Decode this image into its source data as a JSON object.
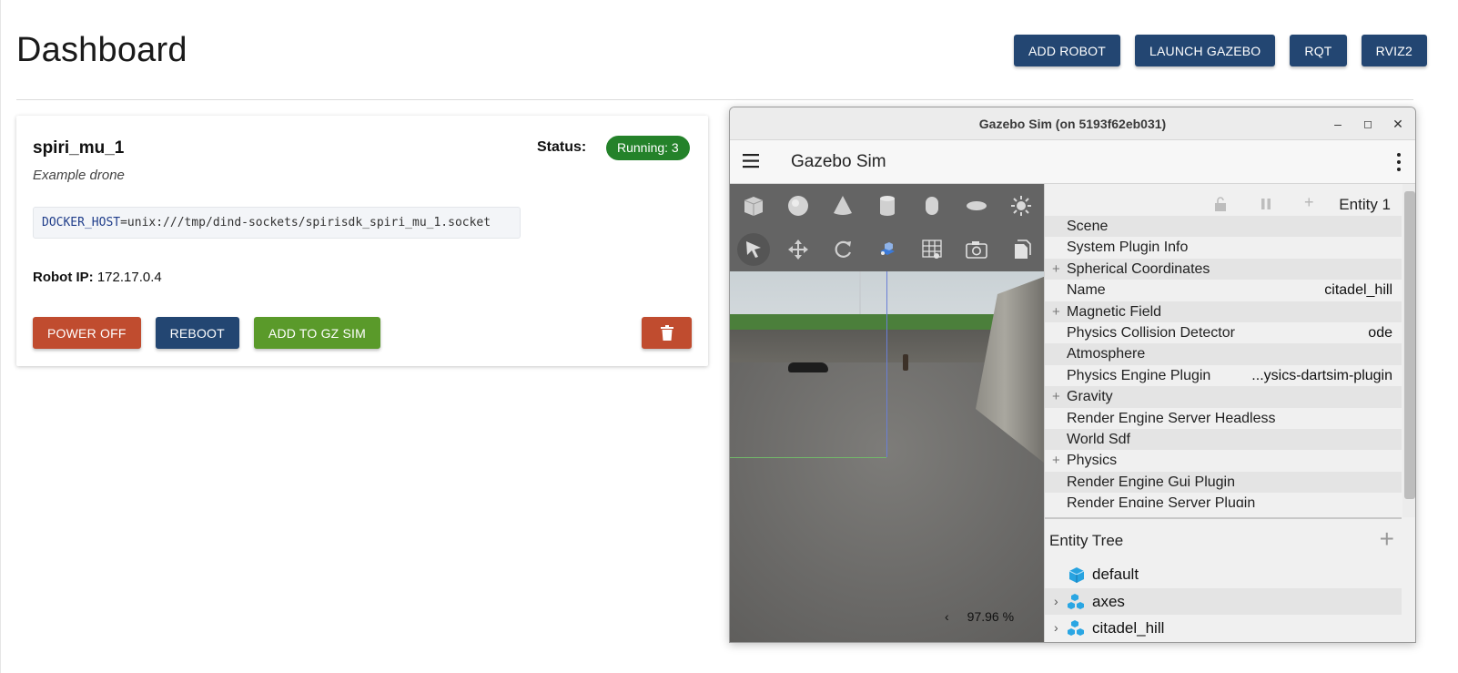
{
  "header": {
    "title": "Dashboard",
    "buttons": [
      "ADD ROBOT",
      "LAUNCH GAZEBO",
      "RQT",
      "RVIZ2"
    ]
  },
  "robot": {
    "name": "spiri_mu_1",
    "description": "Example drone",
    "status_label": "Status:",
    "status": "Running: 3",
    "env_key": "DOCKER_HOST",
    "env_value": "=unix:///tmp/dind-sockets/spirisdk_spiri_mu_1.socket",
    "ip_label": "Robot IP:",
    "ip": "172.17.0.4",
    "actions": {
      "power_off": "POWER OFF",
      "reboot": "REBOOT",
      "add_to_gz": "ADD TO GZ SIM"
    }
  },
  "gazebo": {
    "window_title": "Gazebo Sim (on 5193f62eb031)",
    "app_title": "Gazebo Sim",
    "window_controls": {
      "minimize": "–",
      "maximize": "◻",
      "close": "✕"
    },
    "toolbar_row1": [
      "box-icon",
      "sphere-icon",
      "cone-icon",
      "cylinder-icon",
      "capsule-icon",
      "ellipsoid-icon",
      "light-icon",
      "lines-icon",
      "grid-points-icon"
    ],
    "toolbar_row2": [
      "select-icon",
      "translate-icon",
      "rotate-icon",
      "view-angle-icon",
      "grid-config-icon",
      "screenshot-icon",
      "copy-icon",
      "paste-icon"
    ],
    "entity_label": "Entity 1",
    "components": [
      {
        "label": "Scene",
        "expand": false,
        "value": ""
      },
      {
        "label": "System Plugin Info",
        "expand": false,
        "value": ""
      },
      {
        "label": "Spherical Coordinates",
        "expand": true,
        "value": ""
      },
      {
        "label": "Name",
        "expand": false,
        "value": "citadel_hill"
      },
      {
        "label": "Magnetic Field",
        "expand": true,
        "value": ""
      },
      {
        "label": "Physics Collision Detector",
        "expand": false,
        "value": "ode"
      },
      {
        "label": "Atmosphere",
        "expand": false,
        "value": ""
      },
      {
        "label": "Physics Engine Plugin",
        "expand": false,
        "value": "...ysics-dartsim-plugin"
      },
      {
        "label": "Gravity",
        "expand": true,
        "value": ""
      },
      {
        "label": "Render Engine Server Headless",
        "expand": false,
        "value": ""
      },
      {
        "label": "World Sdf",
        "expand": false,
        "value": ""
      },
      {
        "label": "Physics",
        "expand": true,
        "value": ""
      },
      {
        "label": "Render Engine Gui Plugin",
        "expand": false,
        "value": ""
      },
      {
        "label": "Render Engine Server Plugin",
        "expand": false,
        "value": ""
      }
    ],
    "entity_tree_title": "Entity Tree",
    "entity_tree": [
      {
        "label": "default",
        "chevron": false
      },
      {
        "label": "axes",
        "chevron": true
      },
      {
        "label": "citadel_hill",
        "chevron": true
      }
    ],
    "rtf": "97.96 %",
    "colors": {
      "accent": "#f25022",
      "toolbar": "#646464"
    }
  }
}
